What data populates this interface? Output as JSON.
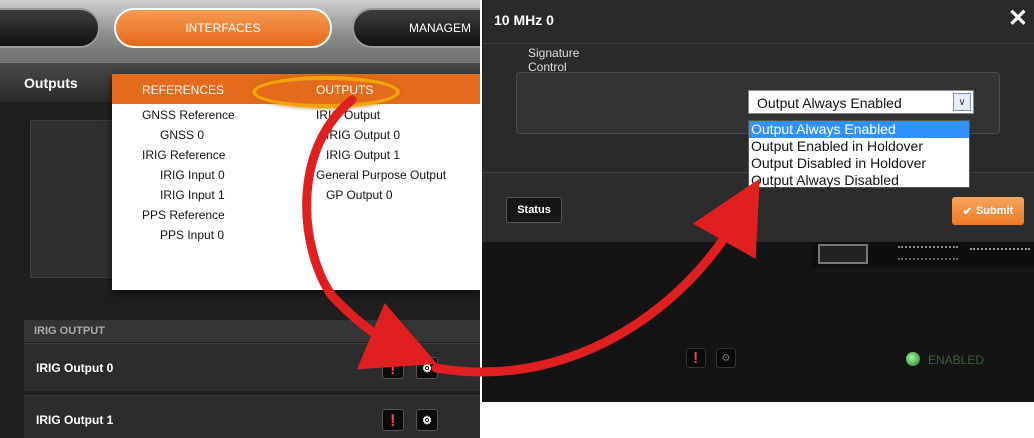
{
  "nav": {
    "interfaces_label": "INTERFACES",
    "management_label": "MANAGEM"
  },
  "outputs_panel": {
    "title": "Outputs"
  },
  "menu": {
    "references_label": "REFERENCES",
    "outputs_label": "OUTPUTS",
    "reference_items": [
      {
        "label": "GNSS Reference",
        "indent": false
      },
      {
        "label": "GNSS 0",
        "indent": true
      },
      {
        "label": "IRIG Reference",
        "indent": false
      },
      {
        "label": "IRIG Input 0",
        "indent": true
      },
      {
        "label": "IRIG Input 1",
        "indent": true
      },
      {
        "label": "PPS Reference",
        "indent": false
      },
      {
        "label": "PPS Input 0",
        "indent": true
      }
    ],
    "output_items": [
      {
        "label": "IRIG Output",
        "indent": false
      },
      {
        "label": "IRIG Output 0",
        "indent": true
      },
      {
        "label": "IRIG Output 1",
        "indent": true
      },
      {
        "label": "General Purpose Output",
        "indent": false
      },
      {
        "label": "GP Output 0",
        "indent": true
      }
    ]
  },
  "irig_section": {
    "header": "IRIG OUTPUT",
    "rows": [
      "IRIG Output 0",
      "IRIG Output 1"
    ],
    "info_icon": "info-icon",
    "settings_icon": "gear-icon"
  },
  "dialog": {
    "title": "10 MHz 0",
    "close_glyph": "✕",
    "signature_label": "Signature Control",
    "selected_value": "Output Always Enabled",
    "options": [
      "Output Always Enabled",
      "Output Enabled in Holdover",
      "Output Disabled in Holdover",
      "Output Always Disabled"
    ],
    "status_button": "Status",
    "submit_button": "Submit",
    "enabled_status": "ENABLED"
  },
  "colors": {
    "accent_orange": "#e46a1c",
    "arrow_red": "#e02020",
    "highlight_yellow": "#f0a30a",
    "selection_blue": "#3390ff"
  }
}
